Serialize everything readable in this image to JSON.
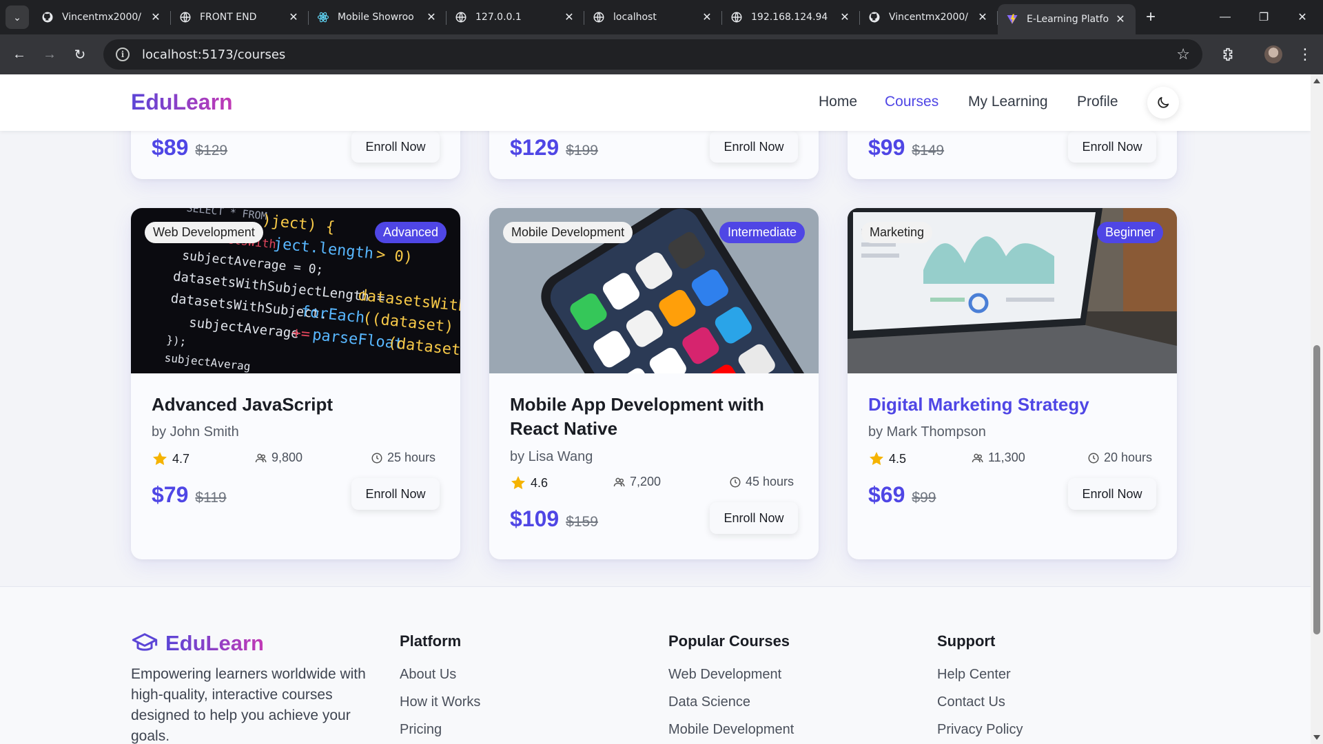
{
  "browser": {
    "tabs": [
      {
        "title": "Vincentmx2000/",
        "icon": "github-icon"
      },
      {
        "title": "FRONT END",
        "icon": "globe-icon"
      },
      {
        "title": "Mobile Showroo",
        "icon": "react-icon"
      },
      {
        "title": "127.0.0.1",
        "icon": "globe-icon"
      },
      {
        "title": "localhost",
        "icon": "globe-icon"
      },
      {
        "title": "192.168.124.94",
        "icon": "globe-icon"
      },
      {
        "title": "Vincentmx2000/",
        "icon": "github-icon"
      },
      {
        "title": "E-Learning Platfo",
        "icon": "vite-icon",
        "active": true
      }
    ],
    "url": "localhost:5173/courses"
  },
  "navbar": {
    "brand": "EduLearn",
    "links": [
      {
        "label": "Home",
        "active": false
      },
      {
        "label": "Courses",
        "active": true
      },
      {
        "label": "My Learning",
        "active": false
      },
      {
        "label": "Profile",
        "active": false
      }
    ],
    "theme_icon": "moon-icon"
  },
  "top_row": [
    {
      "price": "$89",
      "old_price": "$129",
      "cta": "Enroll Now"
    },
    {
      "price": "$129",
      "old_price": "$199",
      "cta": "Enroll Now"
    },
    {
      "price": "$99",
      "old_price": "$149",
      "cta": "Enroll Now"
    }
  ],
  "courses": [
    {
      "category": "Web Development",
      "level": "Advanced",
      "title": "Advanced JavaScript",
      "author": "by John Smith",
      "rating": "4.7",
      "students": "9,800",
      "duration": "25 hours",
      "price": "$79",
      "old_price": "$119",
      "cta": "Enroll Now"
    },
    {
      "category": "Mobile Development",
      "level": "Intermediate",
      "title": "Mobile App Development with React Native",
      "author": "by Lisa Wang",
      "rating": "4.6",
      "students": "7,200",
      "duration": "45 hours",
      "price": "$109",
      "old_price": "$159",
      "cta": "Enroll Now"
    },
    {
      "category": "Marketing",
      "level": "Beginner",
      "title": "Digital Marketing Strategy",
      "author": "by Mark Thompson",
      "rating": "4.5",
      "students": "11,300",
      "duration": "20 hours",
      "price": "$69",
      "old_price": "$99",
      "cta": "Enroll Now"
    }
  ],
  "colors": {
    "accent": "#4f46e5",
    "star": "#f5b301",
    "brand_gradient_start": "#5b45d6",
    "brand_gradient_end": "#c23ab5"
  },
  "footer": {
    "brand": "EduLearn",
    "description": "Empowering learners worldwide with high-quality, interactive courses designed to help you achieve your goals.",
    "columns": [
      {
        "heading": "Platform",
        "links": [
          "About Us",
          "How it Works",
          "Pricing"
        ]
      },
      {
        "heading": "Popular Courses",
        "links": [
          "Web Development",
          "Data Science",
          "Mobile Development"
        ]
      },
      {
        "heading": "Support",
        "links": [
          "Help Center",
          "Contact Us",
          "Privacy Policy"
        ]
      }
    ]
  }
}
